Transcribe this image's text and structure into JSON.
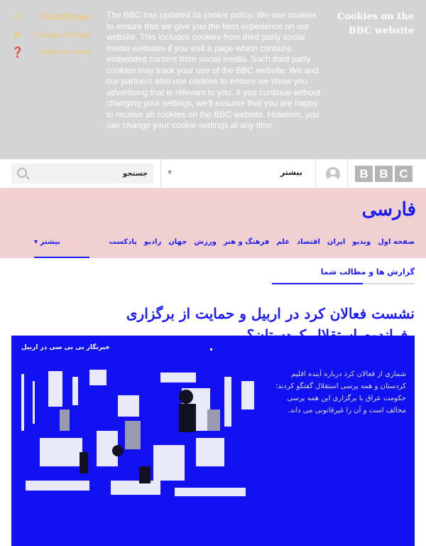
{
  "cookie_banner": {
    "actions": {
      "continue_label": "Continue",
      "change_settings_label": "Change settings",
      "find_out_more_label": "Find out more"
    },
    "message": "The BBC has updated its cookie policy. We use cookies to ensure that we give you the best experience on our website. This includes cookies from third party social media websites if you visit a page which contains embedded content from social media. Such third party cookies may track your use of the BBC website. We and our partners also use cookies to ensure we show you advertising that is relevant to you. If you continue without changing your settings, we'll assume that you are happy to receive all cookies on the BBC website. However, you can change your cookie settings at any time.",
    "title": "Cookies on the BBC website"
  },
  "topbar": {
    "search_placeholder": "جستجو",
    "more_label": "بیشتر",
    "brand_letters": [
      "B",
      "B",
      "C"
    ]
  },
  "masthead": {
    "site_title": "فارسی",
    "nav_items": [
      "صفحه اول",
      "ویدیو",
      "ایران",
      "اقتصاد",
      "علم",
      "فرهنگ و هنر",
      "ورزش",
      "جهان",
      "رادیو",
      "پادکست"
    ],
    "nav_more": "بیشتر"
  },
  "subnav": {
    "label": "گزارش ها و مطالب شما"
  },
  "article": {
    "headline": "نشست فعالان کرد در اربیل و حمایت از برگزاری رفراندوم استقلال کردستان؟",
    "caption": "خبرنگار بی بی سی در اربیل",
    "summary": "شماری از فعالان کرد درباره آینده اقلیم کردستان و همه پرسی استقلال گفتگو کردند؛ حکومت عراق با برگزاری این همه پرسی مخالف است و آن را غیرقانونی می داند."
  },
  "colors": {
    "cookie_bg": "#d4d4d4",
    "cookie_accent": "#e8cc84",
    "masthead_bg": "#f0d0d0",
    "link_blue": "#1a1af5",
    "feature_bg": "#1010f0"
  }
}
